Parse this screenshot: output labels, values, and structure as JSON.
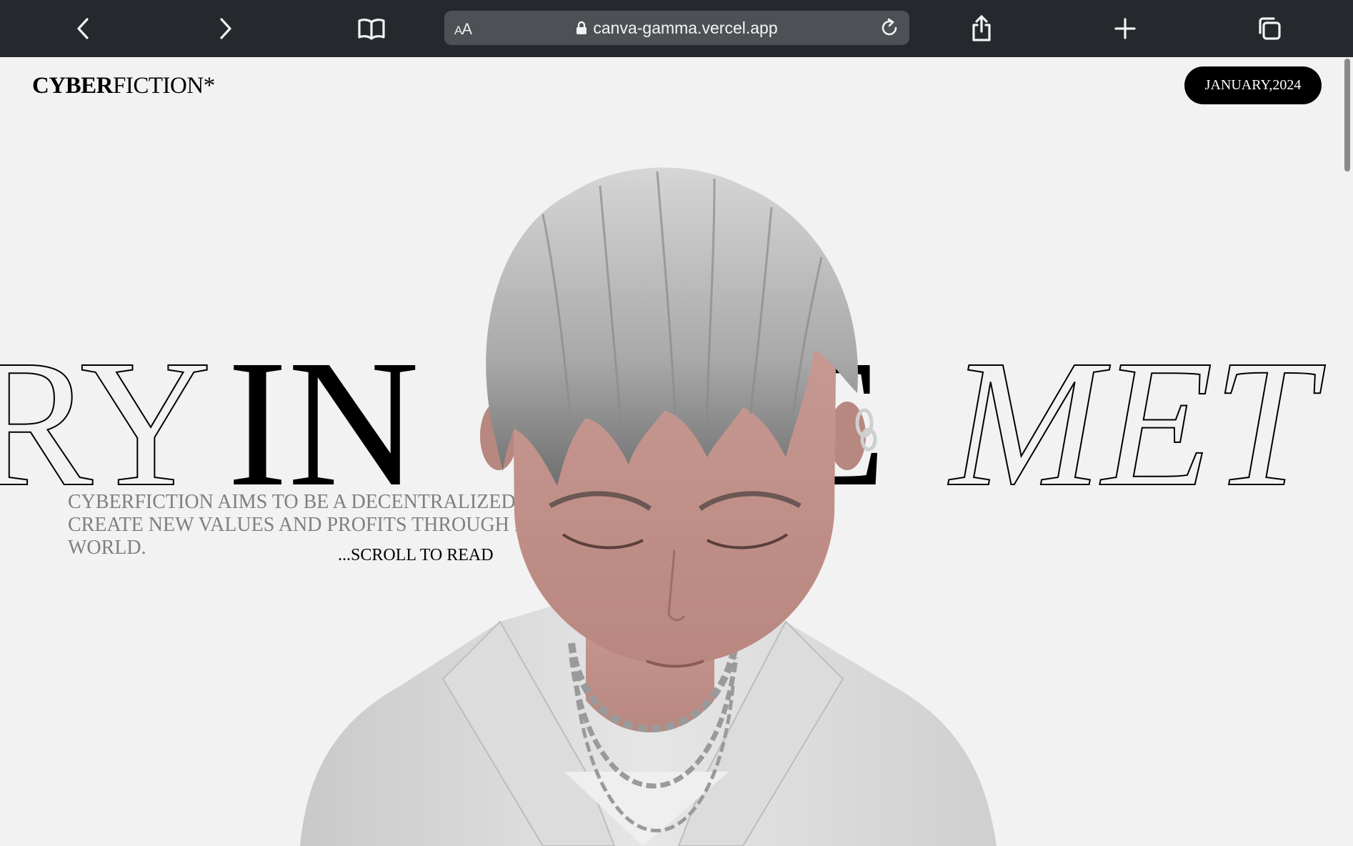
{
  "browser": {
    "address_prefix_big": "A",
    "address_prefix_small": "A",
    "url": "canva-gamma.vercel.app",
    "icons": [
      "back-icon",
      "forward-icon",
      "bookmarks-icon",
      "lock-icon",
      "reload-icon",
      "share-icon",
      "new-tab-icon",
      "tabs-icon"
    ]
  },
  "site": {
    "logo_bold": "CYBER",
    "logo_regular": "FICTION*",
    "date_label": "JANUARY,2024",
    "headline_left": "RY",
    "headline_mid": "IN",
    "headline_hidden": "THE",
    "headline_right": "MET",
    "description": "CYBERFICTION AIMS TO BE A DECENTRALIZED COM CREATE NEW VALUES AND PROFITS THROUGH PLAY WORLD.",
    "description_lines": [
      "CYBERFICTION AIMS TO BE A DECENTRALIZED COM",
      "CREATE NEW VALUES AND PROFITS THROUGH PLAY",
      "WORLD."
    ],
    "scroll_cta": "...SCROLL TO READ",
    "colors": {
      "page_bg": "#f2f2f2",
      "toolbar_bg": "#25282c",
      "pill_bg": "#000000",
      "description_text": "#7f7f7f"
    }
  }
}
